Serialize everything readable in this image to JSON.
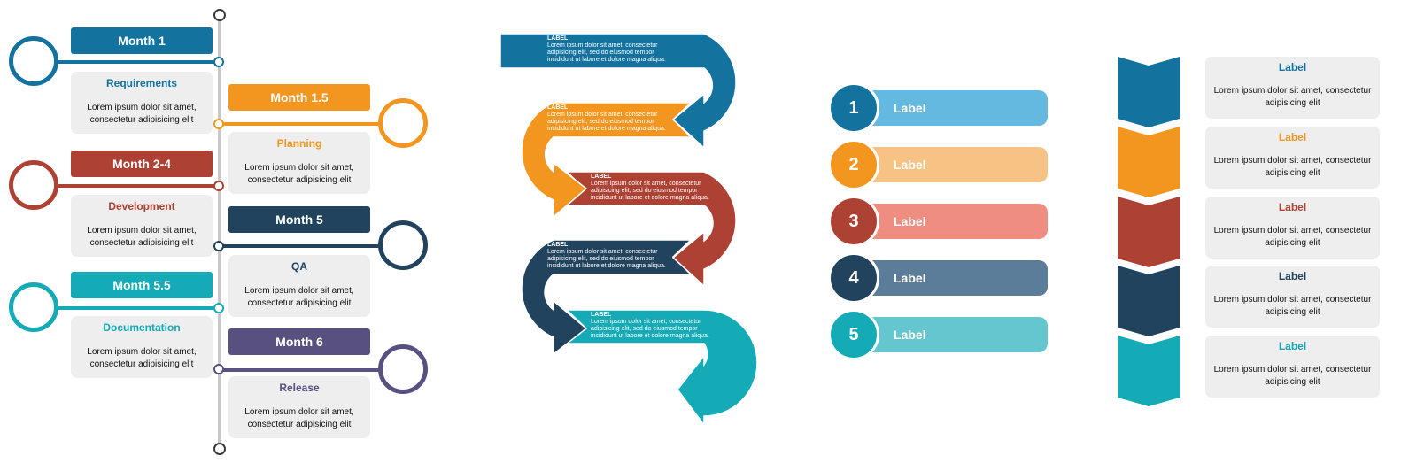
{
  "colors": {
    "blue": "#13739e",
    "orange": "#f29620",
    "red": "#ad4133",
    "navy": "#22435d",
    "teal": "#14aab6",
    "purple": "#58517f",
    "light_blue": "#64b9e0",
    "light_orange": "#f7c384",
    "light_red": "#f08d81",
    "light_navy": "#5c7d99",
    "light_teal": "#64c6ce",
    "card_bg": "#eeeeee",
    "axis": "#c8c8c8"
  },
  "timeline": {
    "milestones": [
      {
        "period": "Month 1",
        "title": "Requirements",
        "desc": "Lorem ipsum dolor sit amet, consectetur adipisicing elit",
        "side": "left",
        "color": "#13739e"
      },
      {
        "period": "Month 1.5",
        "title": "Planning",
        "desc": "Lorem ipsum dolor sit amet, consectetur adipisicing elit",
        "side": "right",
        "color": "#f29620"
      },
      {
        "period": "Month 2-4",
        "title": "Development",
        "desc": "Lorem ipsum dolor sit amet, consectetur adipisicing elit",
        "side": "left",
        "color": "#ad4133"
      },
      {
        "period": "Month 5",
        "title": "QA",
        "desc": "Lorem ipsum dolor sit amet, consectetur adipisicing elit",
        "side": "right",
        "color": "#22435d"
      },
      {
        "period": "Month 5.5",
        "title": "Documentation",
        "desc": "Lorem ipsum dolor sit amet, consectetur adipisicing elit",
        "side": "left",
        "color": "#14aab6"
      },
      {
        "period": "Month 6",
        "title": "Release",
        "desc": "Lorem ipsum dolor sit amet, consectetur adipisicing elit",
        "side": "right",
        "color": "#58517f"
      }
    ]
  },
  "snake": {
    "steps": [
      {
        "label": "LABEL",
        "text": "Lorem ipsum dolor sit amet, consectetur adipisicing elit, sed do eiusmod tempor incididunt ut labore et dolore magna aliqua.",
        "color": "#13739e"
      },
      {
        "label": "LABEL",
        "text": "Lorem ipsum dolor sit amet, consectetur adipisicing elit, sed do eiusmod tempor incididunt ut labore et dolore magna aliqua.",
        "color": "#f29620"
      },
      {
        "label": "LABEL",
        "text": "Lorem ipsum dolor sit amet, consectetur adipisicing elit, sed do eiusmod tempor incididunt ut labore et dolore magna aliqua.",
        "color": "#ad4133"
      },
      {
        "label": "LABEL",
        "text": "Lorem ipsum dolor sit amet, consectetur adipisicing elit, sed do eiusmod tempor incididunt ut labore et dolore magna aliqua.",
        "color": "#22435d"
      },
      {
        "label": "LABEL",
        "text": "Lorem ipsum dolor sit amet, consectetur adipisicing elit, sed do eiusmod tempor incididunt ut labore et dolore magna aliqua.",
        "color": "#14aab6"
      }
    ]
  },
  "numbered_list": {
    "items": [
      {
        "number": "1",
        "label": "Label",
        "color": "#13739e",
        "light": "#64b9e0"
      },
      {
        "number": "2",
        "label": "Label",
        "color": "#f29620",
        "light": "#f7c384"
      },
      {
        "number": "3",
        "label": "Label",
        "color": "#ad4133",
        "light": "#f08d81"
      },
      {
        "number": "4",
        "label": "Label",
        "color": "#22435d",
        "light": "#5c7d99"
      },
      {
        "number": "5",
        "label": "Label",
        "color": "#14aab6",
        "light": "#64c6ce"
      }
    ]
  },
  "chevron_list": {
    "items": [
      {
        "label": "Label",
        "desc": "Lorem ipsum dolor sit amet, consectetur adipisicing elit",
        "color": "#13739e"
      },
      {
        "label": "Label",
        "desc": "Lorem ipsum dolor sit amet, consectetur adipisicing elit",
        "color": "#f29620"
      },
      {
        "label": "Label",
        "desc": "Lorem ipsum dolor sit amet, consectetur adipisicing elit",
        "color": "#ad4133"
      },
      {
        "label": "Label",
        "desc": "Lorem ipsum dolor sit amet, consectetur adipisicing elit",
        "color": "#22435d"
      },
      {
        "label": "Label",
        "desc": "Lorem ipsum dolor sit amet, consectetur adipisicing elit",
        "color": "#14aab6"
      }
    ]
  }
}
